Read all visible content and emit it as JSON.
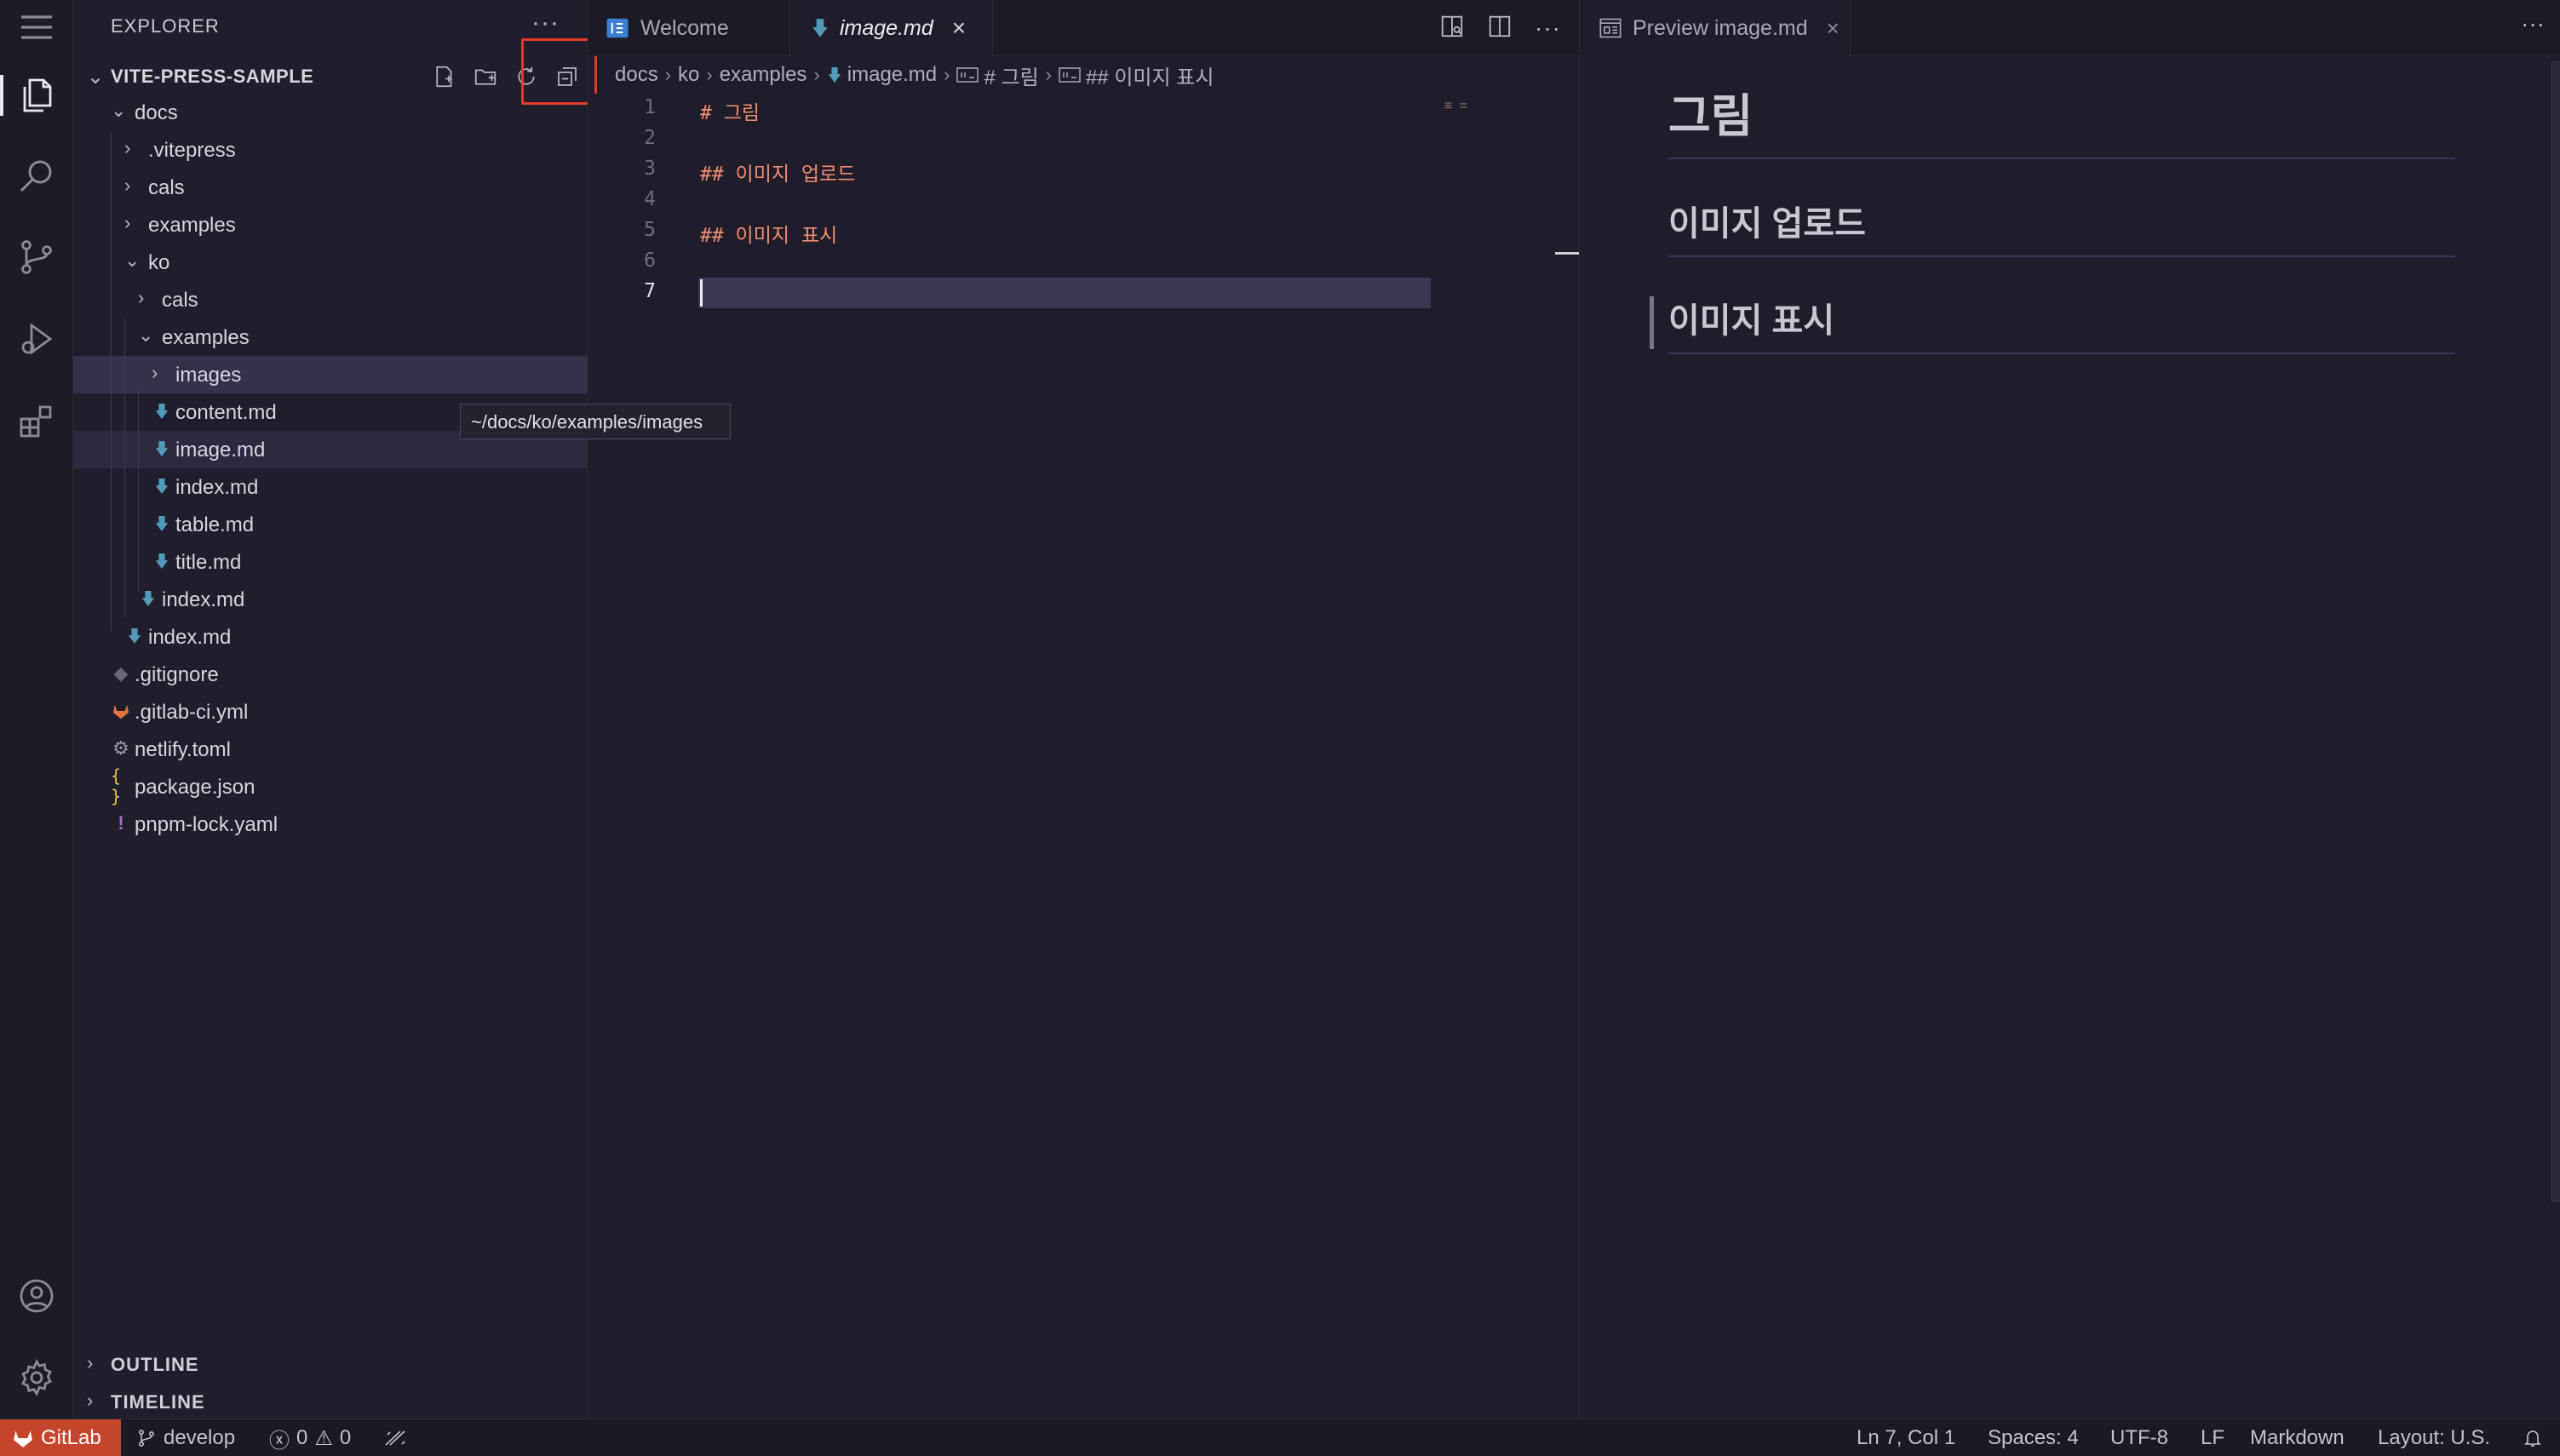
{
  "explorer": {
    "title": "EXPLORER",
    "root": "VITE-PRESS-SAMPLE",
    "tooltip": "~/docs/ko/examples/images",
    "tree": [
      {
        "label": "docs",
        "type": "folder",
        "expanded": true,
        "depth": 1
      },
      {
        "label": ".vitepress",
        "type": "folder",
        "expanded": false,
        "depth": 2
      },
      {
        "label": "cals",
        "type": "folder",
        "expanded": false,
        "depth": 2
      },
      {
        "label": "examples",
        "type": "folder",
        "expanded": false,
        "depth": 2
      },
      {
        "label": "ko",
        "type": "folder",
        "expanded": true,
        "depth": 2
      },
      {
        "label": "cals",
        "type": "folder",
        "expanded": false,
        "depth": 3
      },
      {
        "label": "examples",
        "type": "folder",
        "expanded": true,
        "depth": 3
      },
      {
        "label": "images",
        "type": "folder",
        "expanded": false,
        "depth": 4,
        "state": "selected"
      },
      {
        "label": "content.md",
        "type": "md",
        "depth": 4
      },
      {
        "label": "image.md",
        "type": "md",
        "depth": 4,
        "state": "active"
      },
      {
        "label": "index.md",
        "type": "md",
        "depth": 4
      },
      {
        "label": "table.md",
        "type": "md",
        "depth": 4
      },
      {
        "label": "title.md",
        "type": "md",
        "depth": 4
      },
      {
        "label": "index.md",
        "type": "md",
        "depth": 3
      },
      {
        "label": "index.md",
        "type": "md",
        "depth": 2
      },
      {
        "label": ".gitignore",
        "type": "git",
        "depth": 1
      },
      {
        "label": ".gitlab-ci.yml",
        "type": "gitlab",
        "depth": 1
      },
      {
        "label": "netlify.toml",
        "type": "gear",
        "depth": 1
      },
      {
        "label": "package.json",
        "type": "json",
        "depth": 1
      },
      {
        "label": "pnpm-lock.yaml",
        "type": "yaml",
        "depth": 1
      }
    ],
    "outline": "OUTLINE",
    "timeline": "TIMELINE"
  },
  "tabs": [
    {
      "label": "Welcome",
      "active": false
    },
    {
      "label": "image.md",
      "active": true
    }
  ],
  "breadcrumbs": [
    "docs",
    "ko",
    "examples",
    "image.md",
    "# 그림",
    "## 이미지 표시"
  ],
  "editor": {
    "lines": [
      {
        "n": "1",
        "text": "# 그림"
      },
      {
        "n": "2",
        "text": ""
      },
      {
        "n": "3",
        "text": "## 이미지 업로드"
      },
      {
        "n": "4",
        "text": ""
      },
      {
        "n": "5",
        "text": "## 이미지 표시"
      },
      {
        "n": "6",
        "text": ""
      },
      {
        "n": "7",
        "text": ""
      }
    ]
  },
  "preview": {
    "tab_label": "Preview image.md",
    "h1": "그림",
    "h2a": "이미지 업로드",
    "h2b": "이미지 표시"
  },
  "status": {
    "remote": "GitLab",
    "branch": "develop",
    "errors": "0",
    "warnings": "0",
    "position": "Ln 7, Col 1",
    "spaces": "Spaces: 4",
    "encoding": "UTF-8",
    "eol": "LF",
    "language": "Markdown",
    "layout": "Layout: U.S."
  },
  "colors": {
    "accent_highlight": "#e23a2a",
    "gitlab_remote": "#c4452c",
    "markdown_heading": "#f08c6e",
    "md_file_icon": "#519aba"
  }
}
